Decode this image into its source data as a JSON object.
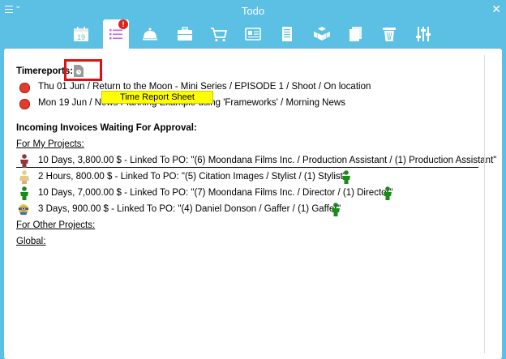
{
  "window": {
    "title": "Todo"
  },
  "toolbar": {
    "calendar_day": "19",
    "todo_badge": "!",
    "items": [
      "calendar-icon",
      "todo-list-icon",
      "bell-icon",
      "briefcase-icon",
      "cart-icon",
      "card-icon",
      "film-icon",
      "boxes-icon",
      "pages-icon",
      "trash-icon",
      "sliders-icon"
    ]
  },
  "timereports": {
    "heading": "Timereports:",
    "tooltip": "Time Report Sheet",
    "items": [
      {
        "text": "Thu 01 Jun / Return to the Moon - Mini Series / EPISODE 1 / Shoot / On location"
      },
      {
        "text": "Mon 19 Jun / News Planning Example using 'Frameworks' / Morning News"
      }
    ]
  },
  "invoices": {
    "heading": "Incoming Invoices Waiting For Approval:",
    "my_projects_label": "For My Projects:",
    "items": [
      {
        "text": "10 Days, 3,800.00 $ - Linked To PO: \"(6) Moondana Films Inc. / Production Assistant / (1) Production Assistant\"",
        "icon": "person-maroon-icon",
        "trailing": false
      },
      {
        "text": "2 Hours, 800.00 $ - Linked To PO: \"(5) Citation Images / Stylist / (1) Stylist\"",
        "icon": "person-beige-icon",
        "trailing": true
      },
      {
        "text": "10 Days, 7,000.00 $ - Linked To PO: \"(7) Moondana Films Inc. / Director / (1) Director\"",
        "icon": "person-green-icon",
        "trailing": true
      },
      {
        "text": "3 Days, 900.00 $ - Linked To PO: \"(4) Daniel Donson / Gaffer / (1) Gaffer\"",
        "icon": "person-minion-icon",
        "trailing": true
      }
    ],
    "other_projects_label": "For Other Projects:",
    "global_label": "Global:"
  },
  "colors": {
    "accent": "#5bc0e4",
    "status_red": "#e23a2c",
    "tooltip": "#ffff00",
    "green_person": "#1a8a1a"
  }
}
